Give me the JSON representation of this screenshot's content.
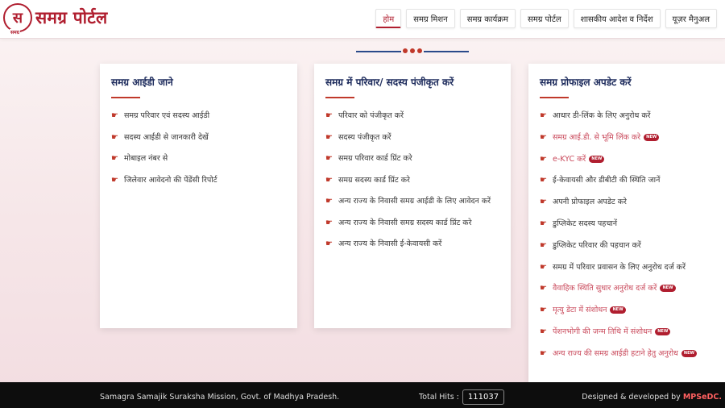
{
  "header": {
    "logo_text": "स",
    "logo_tag": "समग्र",
    "brand": "समग्र पोर्टल",
    "nav": [
      {
        "label": "होम",
        "active": true
      },
      {
        "label": "समग्र मिशन",
        "active": false
      },
      {
        "label": "समग्र कार्यक्रम",
        "active": false
      },
      {
        "label": "समग्र पोर्टल",
        "active": false
      },
      {
        "label": "शासकीय आदेश व निर्देश",
        "active": false
      },
      {
        "label": "यूज़र मैनुअल",
        "active": false
      }
    ]
  },
  "cards": [
    {
      "title": "समग्र आईडी जाने",
      "items": [
        {
          "label": "समग्र परिवार एवं सदस्य आईडी"
        },
        {
          "label": "सदस्य आईडी से जानकारी देखें"
        },
        {
          "label": "मोबाइल नंबर से"
        },
        {
          "label": "जिलेवार आवेदनो की पेंडेंसी रिपोर्ट"
        }
      ]
    },
    {
      "title": "समग्र में परिवार/ सदस्य पंजीकृत करें",
      "items": [
        {
          "label": "परिवार को पंजीकृत करें"
        },
        {
          "label": "सदस्य पंजीकृत करें"
        },
        {
          "label": "समग्र परिवार कार्ड प्रिंट करे"
        },
        {
          "label": "समग्र सदस्य कार्ड प्रिंट करे"
        },
        {
          "label": "अन्य राज्य के निवासी समग्र आईडी के लिए आवेदन करें"
        },
        {
          "label": "अन्य राज्य के निवासी समग्र सदस्य कार्ड प्रिंट करे"
        },
        {
          "label": "अन्य राज्य के निवासी ई-केवायसी करें"
        }
      ]
    },
    {
      "title": "समग्र प्रोफाइल अपडेट करें",
      "items": [
        {
          "label": "आधार डी-लिंक के लिए अनुरोध करें",
          "highlight": false,
          "new": false
        },
        {
          "label": "समग्र आई.डी. से भूमि लिंक करे",
          "highlight": true,
          "new": true
        },
        {
          "label": "e-KYC करें",
          "highlight": true,
          "new": true
        },
        {
          "label": "ई-केवायसी और डीबीटी की स्थिति जानें",
          "highlight": false,
          "new": false
        },
        {
          "label": "अपनी प्रोफाइल अपडेट करे",
          "highlight": false,
          "new": false
        },
        {
          "label": "डुप्लिकेट सदस्य पहचानें",
          "highlight": false,
          "new": false
        },
        {
          "label": "डुप्लिकेट परिवार की पहचान करें",
          "highlight": false,
          "new": false
        },
        {
          "label": "समग्र में परिवार प्रवासन के लिए अनुरोध दर्ज करें",
          "highlight": false,
          "new": false
        },
        {
          "label": "वैवाहिक स्थिति सुधार अनुरोध दर्ज करें",
          "highlight": true,
          "new": true
        },
        {
          "label": "मृत्यु डेटा में संशोधन",
          "highlight": true,
          "new": true
        },
        {
          "label": "पेंशनभोगी की जन्म तिथि में संशोधन",
          "highlight": true,
          "new": true
        },
        {
          "label": "अन्य राज्य की समग्र आईडी हटाने हेतु अनुरोध",
          "highlight": true,
          "new": true
        }
      ]
    }
  ],
  "badge_text": "NEW",
  "footer": {
    "left": "Samagra Samajik Suraksha Mission, Govt. of Madhya Pradesh.",
    "hits_label": "Total Hits :",
    "hits_value": "111037",
    "designed_by": "Designed & developed by",
    "developer": "MPSeDC."
  }
}
